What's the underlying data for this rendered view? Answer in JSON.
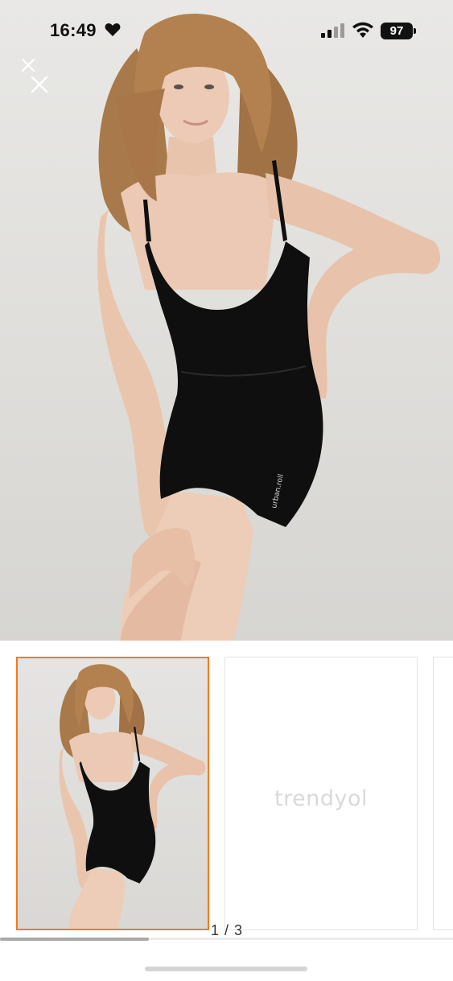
{
  "status_bar": {
    "time": "16:49",
    "battery": "97",
    "icons": [
      "heart-icon",
      "signal-icon",
      "wifi-icon",
      "battery-icon"
    ]
  },
  "gallery": {
    "close_icon": "close-icon",
    "main_image": "product-photo-black-romper",
    "thumbnails": [
      {
        "type": "photo",
        "selected": true
      },
      {
        "type": "placeholder",
        "text": "trendyol",
        "selected": false
      },
      {
        "type": "placeholder",
        "text": "",
        "selected": false
      }
    ],
    "pager": "1 / 3",
    "scroll_progress": 0.33
  },
  "colors": {
    "accent": "#f27a1a",
    "background": "#ffffff",
    "placeholder_text": "#d9d9d9"
  }
}
